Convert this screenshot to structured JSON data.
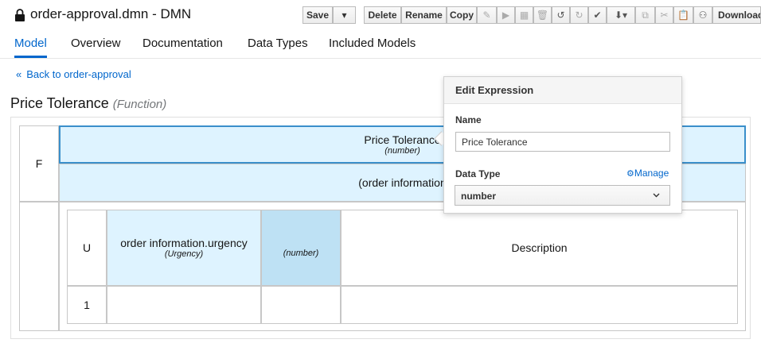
{
  "window": {
    "title": "order-approval.dmn - DMN"
  },
  "toolbar": {
    "save": "Save",
    "save_menu": "▾",
    "delete": "Delete",
    "rename": "Rename",
    "copy": "Copy",
    "download": "Download"
  },
  "tabs": [
    "Model",
    "Overview",
    "Documentation",
    "Data Types",
    "Included Models"
  ],
  "back_link": "Back to order-approval",
  "back_chevron": "«",
  "heading": {
    "name": "Price Tolerance",
    "kind": "(Function)"
  },
  "grid": {
    "function_label": "F",
    "header_name": "Price Tolerance",
    "header_type": "(number)",
    "params": "(order information",
    "hit_policy": "U",
    "input_name": "order information.urgency",
    "input_type": "(Urgency)",
    "output_type": "(number)",
    "description": "Description",
    "row_number": "1"
  },
  "popover": {
    "title": "Edit Expression",
    "name_label": "Name",
    "name_value": "Price Tolerance",
    "type_label": "Data Type",
    "manage": "Manage",
    "type_value": "number"
  },
  "colors": {
    "accent": "#0066cc",
    "header_bg": "#def3ff",
    "output_bg": "#bee1f4"
  }
}
